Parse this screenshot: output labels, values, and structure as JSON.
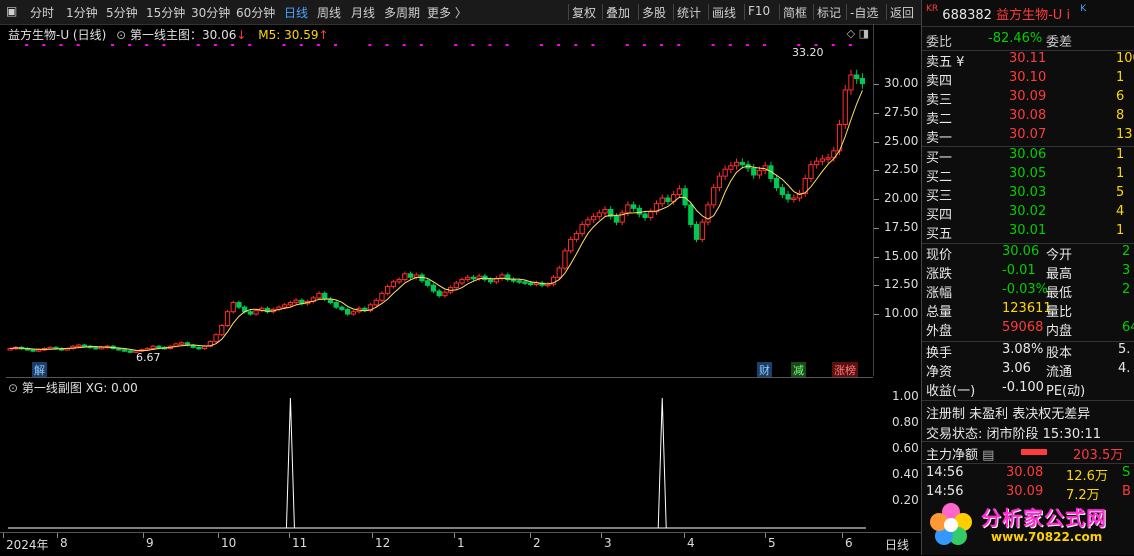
{
  "toolbar": {
    "periods": [
      "分时",
      "1分钟",
      "5分钟",
      "15分钟",
      "30分钟",
      "60分钟",
      "日线",
      "周线",
      "月线",
      "多周期",
      "更多 〉"
    ],
    "active_period": "日线",
    "actions": [
      "复权",
      "叠加",
      "多股",
      "统计",
      "画线",
      "F10",
      "简框",
      "标记",
      "-自选",
      "返回"
    ]
  },
  "main": {
    "stock_title": "益方生物-U (日线)",
    "indicator_label": "第一线主图：30.06",
    "ma_label": "M5: 30.59",
    "high_label": "33.20",
    "low_label": "6.67",
    "badges": {
      "jie": "解",
      "cai": "财",
      "jian": "减",
      "zhangbang": "涨榜"
    },
    "y_ticks": [
      "30.00",
      "27.50",
      "25.00",
      "22.50",
      "20.00",
      "17.50",
      "15.00",
      "12.50",
      "10.00"
    ]
  },
  "sub": {
    "label": "第一线副图 XG: 0.00",
    "y_ticks": [
      "1.00",
      "0.80",
      "0.60",
      "0.40",
      "0.20"
    ]
  },
  "xaxis": {
    "labels": [
      "2024年",
      "8",
      "9",
      "10",
      "11",
      "12",
      "1",
      "2",
      "3",
      "4",
      "5",
      "6"
    ],
    "period": "日线"
  },
  "quote": {
    "code": "688382",
    "name": "益方生物-U",
    "weibi_label": "委比",
    "weibi": "-82.46%",
    "weicha_label": "委差",
    "sell": [
      {
        "label": "卖五 ¥",
        "price": "30.11",
        "vol": "100"
      },
      {
        "label": "卖四",
        "price": "30.10",
        "vol": "1"
      },
      {
        "label": "卖三",
        "price": "30.09",
        "vol": "6"
      },
      {
        "label": "卖二",
        "price": "30.08",
        "vol": "8"
      },
      {
        "label": "卖一",
        "price": "30.07",
        "vol": "13"
      }
    ],
    "buy": [
      {
        "label": "买一",
        "price": "30.06",
        "vol": "1"
      },
      {
        "label": "买二",
        "price": "30.05",
        "vol": "1"
      },
      {
        "label": "买三",
        "price": "30.03",
        "vol": "5"
      },
      {
        "label": "买四",
        "price": "30.02",
        "vol": "4"
      },
      {
        "label": "买五",
        "price": "30.01",
        "vol": "1"
      }
    ],
    "stats": [
      {
        "l1": "现价",
        "v1": "30.06",
        "l2": "今开",
        "v2": "2"
      },
      {
        "l1": "涨跌",
        "v1": "-0.01",
        "l2": "最高",
        "v2": "3"
      },
      {
        "l1": "涨幅",
        "v1": "-0.03%",
        "l2": "最低",
        "v2": "2"
      },
      {
        "l1": "总量",
        "v1": "123611",
        "l2": "量比",
        "v2": ""
      },
      {
        "l1": "外盘",
        "v1": "59068",
        "l2": "内盘",
        "v2": "64"
      }
    ],
    "stats2": [
      {
        "l1": "换手",
        "v1": "3.08%",
        "l2": "股本",
        "v2": "5."
      },
      {
        "l1": "净资",
        "v1": "3.06",
        "l2": "流通",
        "v2": "4."
      },
      {
        "l1": "收益(一)",
        "v1": "-0.100",
        "l2": "PE(动)",
        "v2": ""
      }
    ],
    "tags": "注册制 未盈利 表决权无差异",
    "status": "交易状态: 闭市阶段 15:30:11",
    "netflow_label": "主力净额",
    "netflow": "203.5万",
    "ticks": [
      {
        "time": "14:56",
        "price": "30.08",
        "vol": "12.6万",
        "side": "S"
      },
      {
        "time": "14:56",
        "price": "30.09",
        "vol": "7.2万",
        "side": "B"
      }
    ]
  },
  "watermark": {
    "text": "分析家公式网",
    "url": "www.70822.com"
  },
  "chart_data": {
    "type": "candlestick",
    "ylim": [
      6.0,
      33.5
    ],
    "closes": [
      7.0,
      7.1,
      7.0,
      6.9,
      6.8,
      6.9,
      7.0,
      7.1,
      7.0,
      6.9,
      7.0,
      7.2,
      7.3,
      7.2,
      7.1,
      7.0,
      7.1,
      7.2,
      7.0,
      6.9,
      6.8,
      6.7,
      6.8,
      6.9,
      7.0,
      7.2,
      7.1,
      7.0,
      7.2,
      7.4,
      7.5,
      7.3,
      7.1,
      7.0,
      7.2,
      7.6,
      8.2,
      9.0,
      10.2,
      11.0,
      10.6,
      10.2,
      10.0,
      10.3,
      10.5,
      10.2,
      10.4,
      10.6,
      10.8,
      11.0,
      11.2,
      10.9,
      11.1,
      11.4,
      11.8,
      11.3,
      11.0,
      10.6,
      10.4,
      10.0,
      10.2,
      10.5,
      10.3,
      10.8,
      11.2,
      11.8,
      12.4,
      12.8,
      13.0,
      13.5,
      13.2,
      13.4,
      12.9,
      12.5,
      12.0,
      11.6,
      11.9,
      12.3,
      12.7,
      13.0,
      13.2,
      13.1,
      13.3,
      13.0,
      12.8,
      13.1,
      13.4,
      13.0,
      12.9,
      12.8,
      12.7,
      12.6,
      12.7,
      12.5,
      12.6,
      13.2,
      14.0,
      15.5,
      16.5,
      17.0,
      17.8,
      18.2,
      18.5,
      18.8,
      19.1,
      18.5,
      18.0,
      18.8,
      19.5,
      19.2,
      18.7,
      18.4,
      18.9,
      19.6,
      20.1,
      19.8,
      20.4,
      20.9,
      19.5,
      17.8,
      16.5,
      18.0,
      19.5,
      21.0,
      22.0,
      22.6,
      22.9,
      23.2,
      23.0,
      22.7,
      22.1,
      22.5,
      22.9,
      21.8,
      21.0,
      20.4,
      20.0,
      20.1,
      20.5,
      21.8,
      23.0,
      23.3,
      23.5,
      23.6,
      24.2,
      26.5,
      29.5,
      30.8,
      30.5,
      30.06
    ],
    "ma5_last": 30.59,
    "signal_days_index": [
      49,
      114
    ]
  }
}
